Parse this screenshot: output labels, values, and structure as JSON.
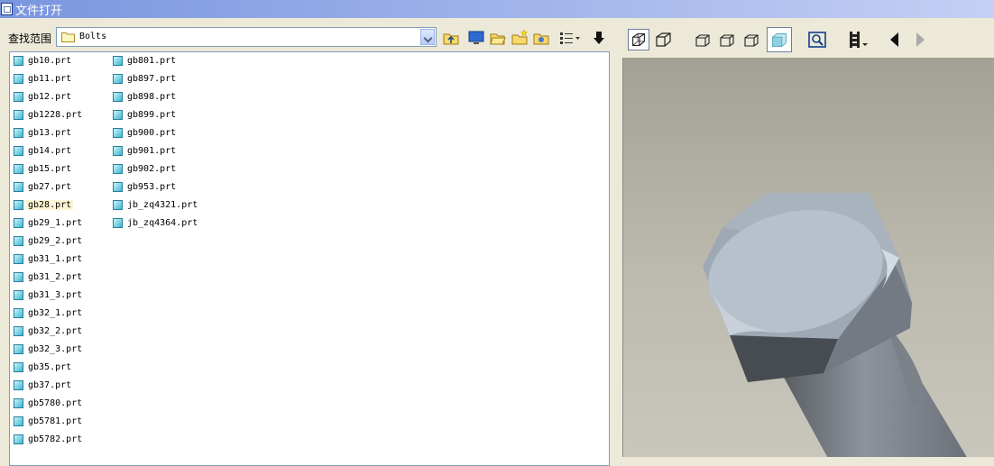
{
  "window": {
    "title": "文件打开"
  },
  "lookin": {
    "label": "查找范围",
    "value": "Bolts"
  },
  "files": {
    "col1": [
      "gb10.prt",
      "gb11.prt",
      "gb12.prt",
      "gb1228.prt",
      "gb13.prt",
      "gb14.prt",
      "gb15.prt",
      "gb27.prt",
      "gb28.prt",
      "gb29_1.prt",
      "gb29_2.prt",
      "gb31_1.prt",
      "gb31_2.prt",
      "gb31_3.prt",
      "gb32_1.prt",
      "gb32_2.prt",
      "gb32_3.prt",
      "gb35.prt",
      "gb37.prt",
      "gb5780.prt",
      "gb5781.prt",
      "gb5782.prt"
    ],
    "col2": [
      "gb801.prt",
      "gb897.prt",
      "gb898.prt",
      "gb899.prt",
      "gb900.prt",
      "gb901.prt",
      "gb902.prt",
      "gb953.prt",
      "jb_zq4321.prt",
      "jb_zq4364.prt"
    ],
    "selected": "gb28.prt"
  },
  "icons": {
    "toolbar": [
      "up-folder-icon",
      "desktop-icon",
      "open-folder-icon",
      "new-folder-icon",
      "favorites-folder-icon",
      "view-list-icon",
      "import-icon"
    ],
    "preview": [
      "wireframe-icon",
      "hidden-line-icon",
      "view-front-icon",
      "view-top-icon",
      "view-right-icon",
      "shaded-icon",
      "zoom-icon",
      "film-strip-icon",
      "prev-icon",
      "next-icon"
    ]
  },
  "colors": {
    "title_gradient_start": "#7a96df",
    "selection": "#fdf5d4",
    "viewport_bg": "#b6b3a8",
    "bolt_face": "#b7c1cb"
  }
}
